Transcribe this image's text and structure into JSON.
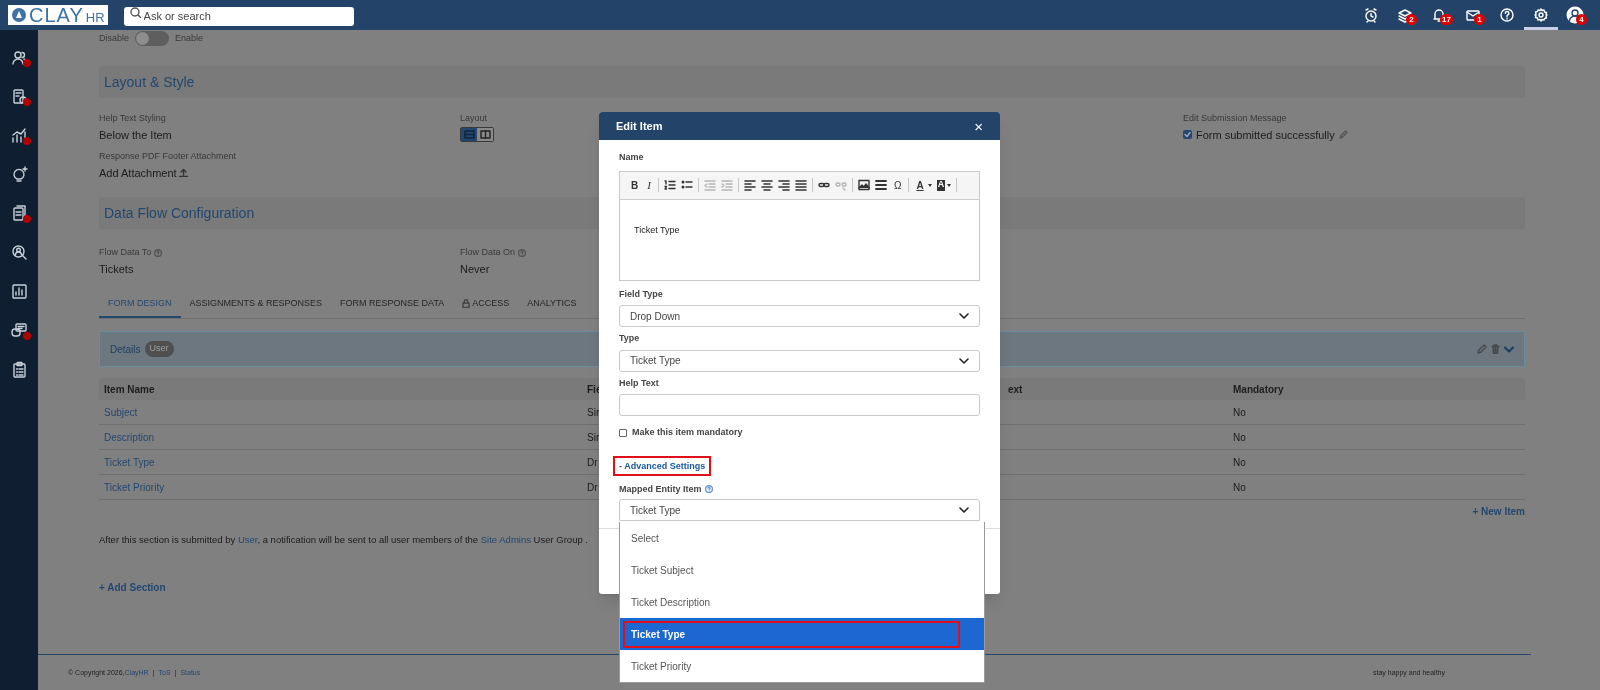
{
  "header": {
    "logo_text": "CLAY",
    "logo_suffix": "HR",
    "search": {
      "placeholder": "Ask or search"
    },
    "icons": [
      {
        "kind": "clock",
        "selected": false
      },
      {
        "kind": "stack",
        "badge": "2",
        "selected": false
      },
      {
        "kind": "bell",
        "badge": "17",
        "selected": false
      },
      {
        "kind": "mail",
        "badge": "1",
        "selected": false
      },
      {
        "kind": "help",
        "selected": false
      },
      {
        "kind": "settings",
        "selected": true
      },
      {
        "kind": "avatar",
        "badge": "4",
        "selected": false
      }
    ]
  },
  "sidebar": {
    "items": [
      {
        "kind": "people",
        "alert": true
      },
      {
        "kind": "report",
        "alert": true
      },
      {
        "kind": "chart",
        "alert": true
      },
      {
        "kind": "bulb",
        "alert": false
      },
      {
        "kind": "docs",
        "alert": true
      },
      {
        "kind": "find",
        "alert": false
      },
      {
        "kind": "bars",
        "alert": false
      },
      {
        "kind": "chat",
        "alert": true
      },
      {
        "kind": "clipboard",
        "alert": false
      }
    ]
  },
  "toggle": {
    "off_label": "Disable",
    "on_label": "Enable",
    "on": false
  },
  "layout_style": {
    "title": "Layout & Style",
    "help_text_styling": {
      "label": "Help Text Styling",
      "value": "Below the Item"
    },
    "layout": {
      "label": "Layout",
      "options": [
        {
          "kind": "rows",
          "selected": true
        },
        {
          "kind": "columns",
          "selected": false
        }
      ]
    },
    "submission": {
      "label": "Edit Submission Message",
      "checked": true,
      "value": "Form submitted successfully"
    },
    "footer_attachment": {
      "label": "Response PDF Footer Attachment",
      "value": "Add Attachment"
    }
  },
  "data_flow": {
    "title": "Data Flow Configuration",
    "flow_to": {
      "label": "Flow Data To",
      "value": "Tickets"
    },
    "flow_on": {
      "label": "Flow Data On",
      "value": "Never"
    }
  },
  "tabs": [
    {
      "label": "FORM DESIGN",
      "selected": true,
      "locked": false
    },
    {
      "label": "ASSIGNMENTS & RESPONSES",
      "selected": false,
      "locked": false
    },
    {
      "label": "FORM RESPONSE DATA",
      "selected": false,
      "locked": false
    },
    {
      "label": "ACCESS",
      "selected": false,
      "locked": true
    },
    {
      "label": "ANALYTICS",
      "selected": false,
      "locked": false
    }
  ],
  "section": {
    "title": "Details",
    "badge": "User"
  },
  "table": {
    "columns": {
      "item_name": "Item Name",
      "column_2": "Fie",
      "column_3": "ext",
      "mandatory": "Mandatory"
    },
    "rows": [
      {
        "item_name": "Subject",
        "column_2": "Sin",
        "mandatory": "No"
      },
      {
        "item_name": "Description",
        "column_2": "Sin",
        "mandatory": "No"
      },
      {
        "item_name": "Ticket Type",
        "column_2": "Dr",
        "mandatory": "No"
      },
      {
        "item_name": "Ticket Priority",
        "column_2": "Dr",
        "mandatory": "No"
      }
    ]
  },
  "new_item": "+ New Item",
  "notice": [
    {
      "text": "After this section is submitted by ",
      "kind": "text"
    },
    {
      "text": "User",
      "kind": "link"
    },
    {
      "text": ", a notification will be sent to all user members of the ",
      "kind": "text"
    },
    {
      "text": "Site Admins",
      "kind": "link"
    },
    {
      "text": " User Group .",
      "kind": "text"
    }
  ],
  "add_section": "+ Add Section",
  "footer": {
    "copyright": "© Copyright 2026, ",
    "company": "ClayHR",
    "sep1": "|",
    "tos": "ToS",
    "sep2": "|",
    "status": "Status",
    "tagline": "stay happy and healthy"
  },
  "modal": {
    "title": "Edit Item",
    "close": "×",
    "name_label": "Name",
    "toolbar": [
      {
        "kind": "bold",
        "label": "B",
        "disabled": false
      },
      {
        "kind": "italic",
        "label": "I",
        "disabled": false
      },
      {
        "kind": "sep"
      },
      {
        "kind": "numbered",
        "disabled": false
      },
      {
        "kind": "bullets",
        "disabled": false
      },
      {
        "kind": "sep"
      },
      {
        "kind": "outdent",
        "disabled": true
      },
      {
        "kind": "indent",
        "disabled": true
      },
      {
        "kind": "sep"
      },
      {
        "kind": "left",
        "disabled": false
      },
      {
        "kind": "center",
        "disabled": false
      },
      {
        "kind": "right",
        "disabled": false
      },
      {
        "kind": "justify",
        "disabled": false
      },
      {
        "kind": "sep"
      },
      {
        "kind": "link",
        "disabled": false
      },
      {
        "kind": "unlink",
        "disabled": true
      },
      {
        "kind": "sep"
      },
      {
        "kind": "image",
        "disabled": false
      },
      {
        "kind": "rule",
        "disabled": false
      },
      {
        "kind": "omega",
        "label": "Ω",
        "disabled": false
      },
      {
        "kind": "sep"
      },
      {
        "kind": "textcolor",
        "label": "A",
        "disabled": false
      },
      {
        "kind": "bgcolor",
        "label": "A",
        "disabled": false
      },
      {
        "kind": "sep"
      }
    ],
    "name_value": "Ticket Type",
    "field_type": {
      "label": "Field Type",
      "value": "Drop Down"
    },
    "type": {
      "label": "Type",
      "value": "Ticket Type"
    },
    "help_text": {
      "label": "Help Text"
    },
    "mandatory": {
      "label": "Make this item mandatory",
      "checked": false
    },
    "advanced": {
      "label": "- Advanced Settings",
      "annotated": true
    },
    "mapped": {
      "label": "Mapped Entity Item",
      "value": "Ticket Type",
      "options": [
        {
          "label": "Select",
          "selected": false,
          "annotated": false
        },
        {
          "label": "Ticket Subject",
          "selected": false,
          "annotated": false
        },
        {
          "label": "Ticket Description",
          "selected": false,
          "annotated": false
        },
        {
          "label": "Ticket Type",
          "selected": true,
          "annotated": true
        },
        {
          "label": "Ticket Priority",
          "selected": false,
          "annotated": false
        }
      ]
    }
  }
}
